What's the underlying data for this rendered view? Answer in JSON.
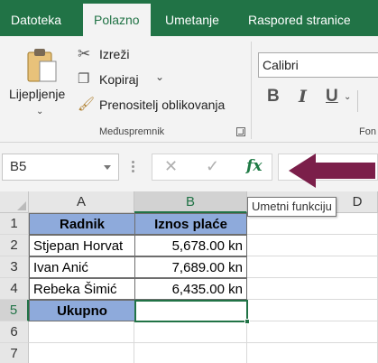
{
  "ribbon_tabs": [
    "Datoteka",
    "Polazno",
    "Umetanje",
    "Raspored stranice"
  ],
  "active_tab": "Polazno",
  "clipboard": {
    "paste_label": "Lijepljenje",
    "cut_label": "Izreži",
    "copy_label": "Kopiraj",
    "format_painter_label": "Prenositelj oblikovanja",
    "group_label": "Međuspremnik"
  },
  "font_group": {
    "font_name": "Calibri",
    "bold": "B",
    "italic": "I",
    "underline": "U",
    "group_label_partial": "Fon"
  },
  "formula_bar": {
    "name_box": "B5",
    "formula_value": "",
    "fx_label": "fx",
    "tooltip": "Umetni funkciju"
  },
  "grid": {
    "columns": [
      "A",
      "B",
      "D"
    ],
    "rows": [
      "1",
      "2",
      "3",
      "4",
      "5",
      "6",
      "7"
    ],
    "header": [
      "Radnik",
      "Iznos plaće"
    ],
    "data": [
      [
        "Stjepan Horvat",
        "5,678.00 kn"
      ],
      [
        "Ivan Anić",
        "7,689.00 kn"
      ],
      [
        "Rebeka Šimić",
        "6,435.00 kn"
      ]
    ],
    "total_label": "Ukupno",
    "total_value": "",
    "selected_cell": "B5"
  },
  "colors": {
    "brand_green": "#217346",
    "header_fill": "#8eaadb",
    "arrow": "#7b1f4a"
  }
}
